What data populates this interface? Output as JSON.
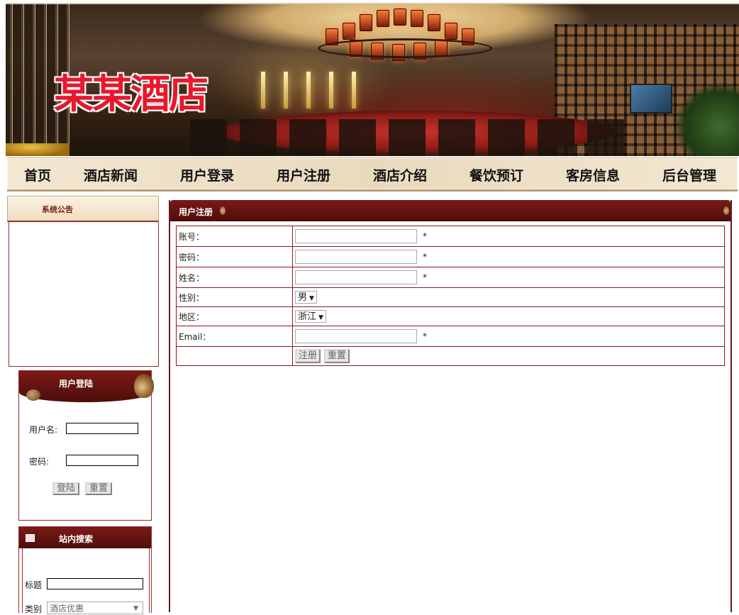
{
  "site": {
    "title": "某某酒店"
  },
  "nav": {
    "items": [
      "首页",
      "酒店新闻",
      "用户登录",
      "用户注册",
      "酒店介绍",
      "餐饮预订",
      "客房信息",
      "后台管理"
    ]
  },
  "sidebar": {
    "notice_title": "系统公告",
    "login": {
      "title": "用户登陆",
      "username_label": "用户名:",
      "password_label": "密码:",
      "login_button": "登陆",
      "reset_button": "重置"
    },
    "search": {
      "title": "站内搜索",
      "title_label": "标题",
      "category_label": "类别",
      "category_value": "酒店优惠"
    }
  },
  "main": {
    "panel_title": "用户注册",
    "form": {
      "account_label": "账号：",
      "password_label": "密码：",
      "name_label": "姓名：",
      "gender_label": "性别：",
      "gender_value": "男",
      "region_label": "地区：",
      "region_value": "浙江",
      "email_label": "Email：",
      "required_mark": "*",
      "submit_button": "注册",
      "reset_button": "重置"
    }
  },
  "colors": {
    "accent_dark_red": "#6b1a16",
    "title_red": "#e8182e",
    "nav_bg": "#f3e7d2"
  }
}
